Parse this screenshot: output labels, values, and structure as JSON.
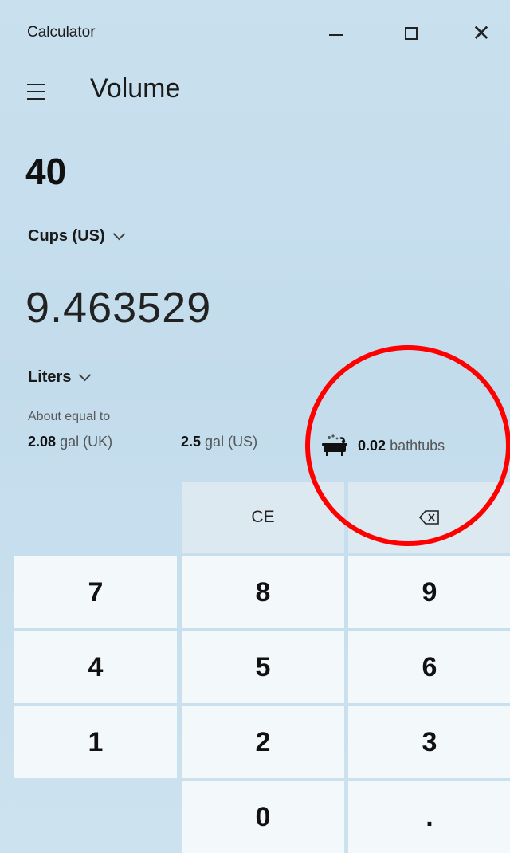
{
  "window": {
    "title": "Calculator"
  },
  "header": {
    "mode": "Volume"
  },
  "converter": {
    "input_value": "40",
    "from_unit": "Cups (US)",
    "output_value": "9.463529",
    "to_unit": "Liters",
    "about_label": "About equal to",
    "equivalents": [
      {
        "value": "2.08",
        "unit": "gal (UK)"
      },
      {
        "value": "2.5",
        "unit": "gal (US)"
      },
      {
        "value": "0.02",
        "unit": "bathtubs",
        "icon": "bathtub-icon"
      }
    ]
  },
  "keypad": {
    "ce": "CE",
    "backspace_icon": "backspace-icon",
    "digits": [
      "7",
      "8",
      "9",
      "4",
      "5",
      "6",
      "1",
      "2",
      "3",
      "0",
      "."
    ]
  },
  "colors": {
    "annotation": "#ff0000",
    "key_bg": "#f3f8fb",
    "op_bg": "#dde9f1"
  }
}
